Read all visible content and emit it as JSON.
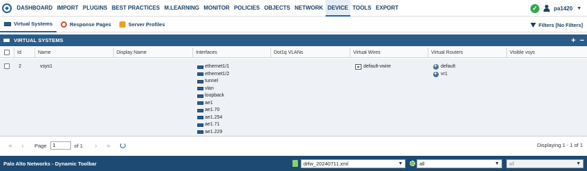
{
  "topnav": {
    "items": [
      "DASHBOARD",
      "IMPORT",
      "PLUGINS",
      "BEST PRACTICES",
      "M.LEARNING",
      "MONITOR",
      "POLICIES",
      "OBJECTS",
      "NETWORK",
      "DEVICE",
      "TOOLS",
      "EXPORT"
    ],
    "active": "DEVICE",
    "user": "pa1420",
    "status_icon": "check-circle-icon"
  },
  "subtabs": {
    "items": [
      {
        "label": "Virtual Systems",
        "icon": "virtual-systems-icon"
      },
      {
        "label": "Response Pages",
        "icon": "response-pages-icon"
      },
      {
        "label": "Server Profiles",
        "icon": "server-profiles-icon"
      }
    ],
    "filters_label": "Filters [No Filters]"
  },
  "section": {
    "title": "VIRTUAL SYSTEMS",
    "add": "+",
    "remove": "−"
  },
  "table": {
    "columns": [
      "Id",
      "Name",
      "Display Name",
      "Interfaces",
      "Dot1q VLANs",
      "Virtual Wires",
      "Virtual Routers",
      "Visible vsys"
    ],
    "rows": [
      {
        "id": "2",
        "name": "vsys1",
        "display_name": "",
        "interfaces": [
          "ethernet1/1",
          "ethernet1/2",
          "tunnel",
          "vlan",
          "loopback",
          "ae1",
          "ae1.70",
          "ae1.254",
          "ae1.71",
          "ae1.229"
        ],
        "dot1q_vlans": "",
        "virtual_wires": [
          "default-vwire"
        ],
        "virtual_routers": [
          "default",
          "vr1"
        ],
        "visible_vsys": ""
      }
    ]
  },
  "pager": {
    "first": "«",
    "prev": "‹",
    "page_label": "Page",
    "page_value": "1",
    "of_label": "of 1",
    "next": "›",
    "last": "»",
    "displaying": "Displaying 1 - 1 of 1"
  },
  "toolbar": {
    "title": "Palo Alto Networks - Dynamic Toolbar",
    "file": "drfw_20240711.xml",
    "select2": "all",
    "select3": "all"
  },
  "colors": {
    "brand": "#1c4a73",
    "section": "#2b5b87",
    "row_bg": "#eef2f7",
    "ok": "#2fa84f"
  }
}
